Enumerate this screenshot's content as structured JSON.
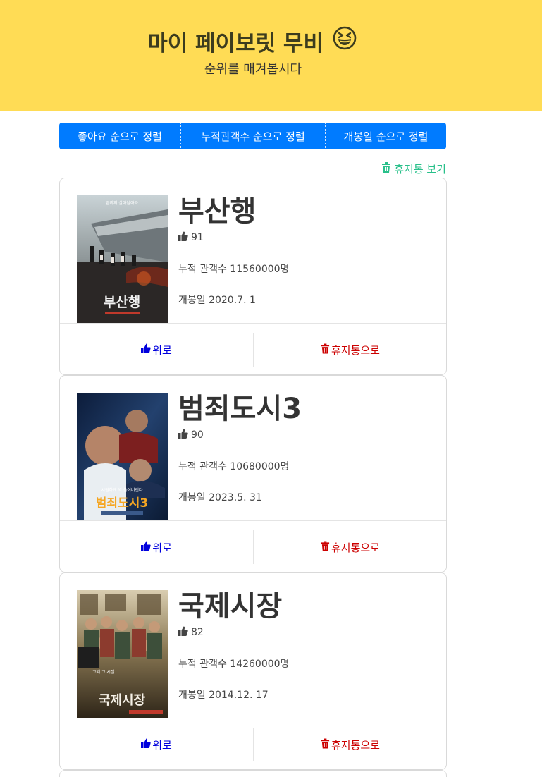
{
  "header": {
    "title": "마이 페이보릿 무비",
    "emoji_icon": "grinning-squinting-face",
    "subtitle": "순위를 매겨봅시다"
  },
  "sort_buttons": [
    "좋아요 순으로 정렬",
    "누적관객수 순으로 정렬",
    "개봉일 순으로 정렬"
  ],
  "trash_link": "휴지통 보기",
  "colors": {
    "hero_bg": "#ffdc55",
    "primary": "#007bff",
    "trash_link": "#28c08a",
    "up_button": "#0000dd",
    "delete_button": "#cc0000"
  },
  "movies": [
    {
      "title": "부산행",
      "likes": "91",
      "audience": "누적 관객수 11560000명",
      "release": "개봉일 2020.7. 1",
      "up_label": "위로",
      "delete_label": "휴지통으로",
      "poster_tagline": "끝까지 살아남아라",
      "poster_title": "부산행"
    },
    {
      "title": "범죄도시3",
      "likes": "90",
      "audience": "누적 관객수 10680000명",
      "release": "개봉일 2023.5. 31",
      "up_label": "위로",
      "delete_label": "휴지통으로",
      "poster_tagline": "시원하게 싹 쓸어버린다",
      "poster_title": "범죄도시3"
    },
    {
      "title": "국제시장",
      "likes": "82",
      "audience": "누적 관객수 14260000명",
      "release": "개봉일 2014.12. 17",
      "up_label": "위로",
      "delete_label": "휴지통으로",
      "poster_tagline": "그때 그 시절",
      "poster_title": "국제시장"
    }
  ]
}
